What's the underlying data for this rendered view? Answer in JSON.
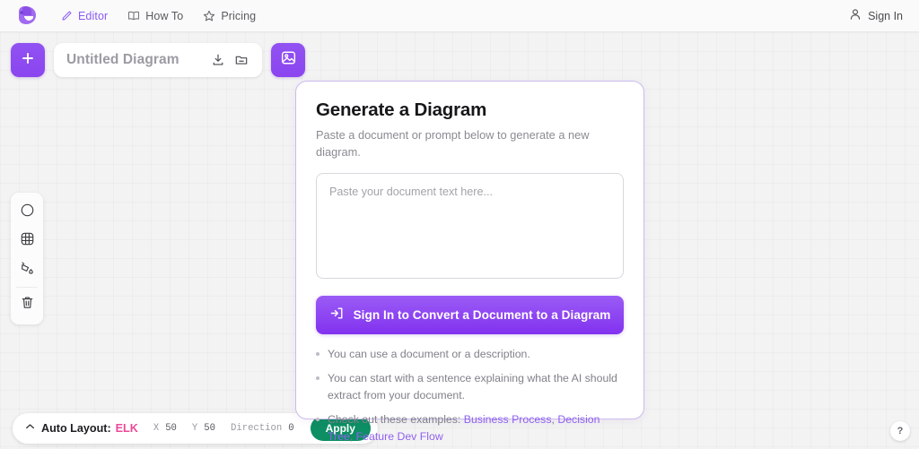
{
  "nav": {
    "logo_icon": "app-logo-icon",
    "links": [
      {
        "label": "Editor",
        "icon": "pencil-icon",
        "active": true
      },
      {
        "label": "How To",
        "icon": "book-icon",
        "active": false
      },
      {
        "label": "Pricing",
        "icon": "star-icon",
        "active": false
      }
    ],
    "signin_label": "Sign In",
    "signin_icon": "user-icon"
  },
  "toolbar": {
    "add_icon": "plus-icon",
    "diagram_title": "Untitled Diagram",
    "diagram_title_placeholder": "Untitled Diagram",
    "download_icon": "download-icon",
    "open_icon": "folder-open-icon",
    "image_icon": "image-icon"
  },
  "rail": {
    "items": [
      {
        "icon": "circle-shape-icon"
      },
      {
        "icon": "grid-table-icon"
      },
      {
        "icon": "paint-bucket-icon"
      },
      {
        "icon": "trash-icon"
      }
    ]
  },
  "modal": {
    "title": "Generate a Diagram",
    "subtitle": "Paste a document or prompt below to generate a new diagram.",
    "textarea_value": "",
    "textarea_placeholder": "Paste your document text here...",
    "cta_label": "Sign In to Convert a Document to a Diagram",
    "cta_icon": "sign-in-icon",
    "hints": [
      {
        "text": "You can use a document or a description."
      },
      {
        "text": "You can start with a sentence explaining what the AI should extract from your document."
      }
    ],
    "examples_prefix": "Check out these examples:",
    "examples": [
      {
        "label": "Business Process"
      },
      {
        "label": "Decision Tree"
      },
      {
        "label": "Feature Dev Flow"
      }
    ]
  },
  "bottombar": {
    "collapse_icon": "chevron-up-icon",
    "label": "Auto Layout:",
    "engine": "ELK",
    "fields": [
      {
        "key": "X",
        "value": "50"
      },
      {
        "key": "Y",
        "value": "50"
      },
      {
        "key": "Direction",
        "value": "0"
      }
    ],
    "apply_label": "Apply"
  },
  "help": {
    "label": "?"
  },
  "colors": {
    "accent_purple": "#8b5cf6",
    "cta_purple": "#8232ef",
    "engine_pink": "#ec4899",
    "apply_green": "#0d8f63",
    "modal_border": "#cdbbee",
    "canvas_bg": "#f3f3f3"
  }
}
